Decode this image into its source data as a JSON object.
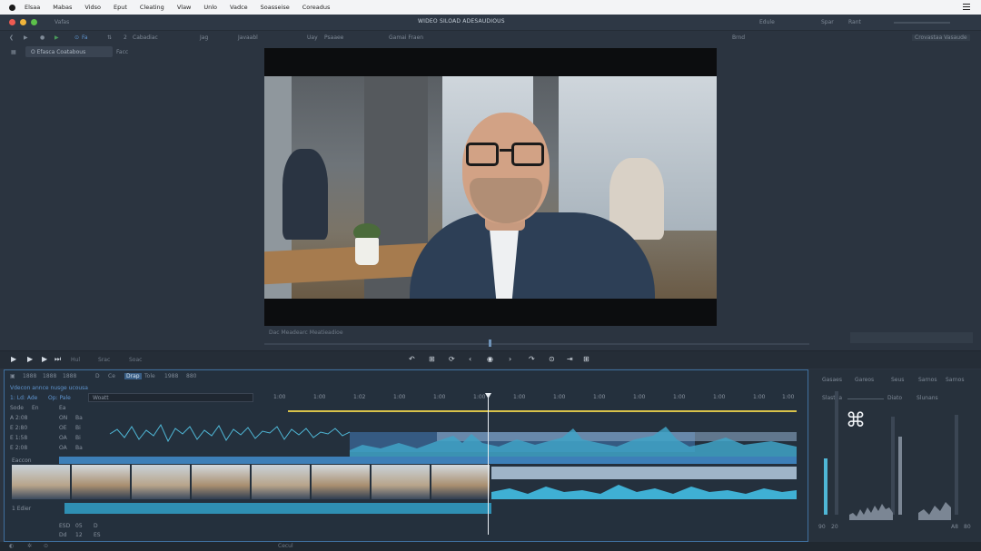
{
  "menubar": {
    "items": [
      "Elsaa",
      "Mabas",
      "Vidso",
      "Eput",
      "Cleating",
      "Vlaw",
      "Unlo",
      "Vadce",
      "Soasseise",
      "Coreadus"
    ]
  },
  "window": {
    "title": "WIDEO SILOAD ADESAUDIOUS",
    "left_tab": "Vafas"
  },
  "titlebar_right": [
    "Edule",
    "Spar",
    "Rant"
  ],
  "toolbar": {
    "left": [
      "Fa",
      "2",
      "Cabadiac",
      "Jag",
      "Javaabl",
      "Uay",
      "Psaaee",
      "Gamai Fraen"
    ],
    "right": [
      "Brnd",
      "Crovastaa Vasaude"
    ]
  },
  "subbar": {
    "clip": "O Efasca Coatabous",
    "mode": "Facc"
  },
  "viewer_status": "Dac  Meadearc  Meatieadioe",
  "transport": {
    "labels": [
      "Hul",
      "Srac",
      "Soac"
    ]
  },
  "timeline": {
    "header": [
      "1888",
      "1888",
      "1888",
      "D",
      "Ce",
      "Drap",
      "Tole",
      "1988",
      "880"
    ],
    "title": "Vdecon annce nusge ucousa",
    "search": "Woatt",
    "top_row": [
      "1: Ld: Ade",
      "Op: Pale"
    ],
    "ruler": [
      "1:00",
      "1:00",
      "1:02",
      "1:00",
      "1:00",
      "1:00",
      "1:00",
      "1:00",
      "1:00",
      "1:00",
      "1:00",
      "1:00",
      "1:00",
      "1:00"
    ],
    "track_rows": [
      [
        "Sode",
        "En",
        "Ea"
      ],
      [
        "A  2:08",
        "ON",
        "Ba"
      ],
      [
        "E  2:80",
        "OE",
        "Bi"
      ],
      [
        "E  1:58",
        "OA",
        "Bi"
      ],
      [
        "E  2:08",
        "OA",
        "Ba"
      ]
    ],
    "video_track": "Eaccon",
    "audio_track": "1 Edier",
    "bottom_rows": [
      [
        "ESD",
        "05",
        "D"
      ],
      [
        "Dd",
        "12",
        "ES"
      ]
    ]
  },
  "mixer": {
    "labels": [
      "Gasaes",
      "Gareos",
      "Seus",
      "Sarnos"
    ],
    "sub": [
      "Slastha",
      "Diato",
      "Slunans"
    ],
    "readouts": [
      "90",
      "20",
      "A8",
      "80"
    ]
  },
  "bottom_bar": "Cecul"
}
